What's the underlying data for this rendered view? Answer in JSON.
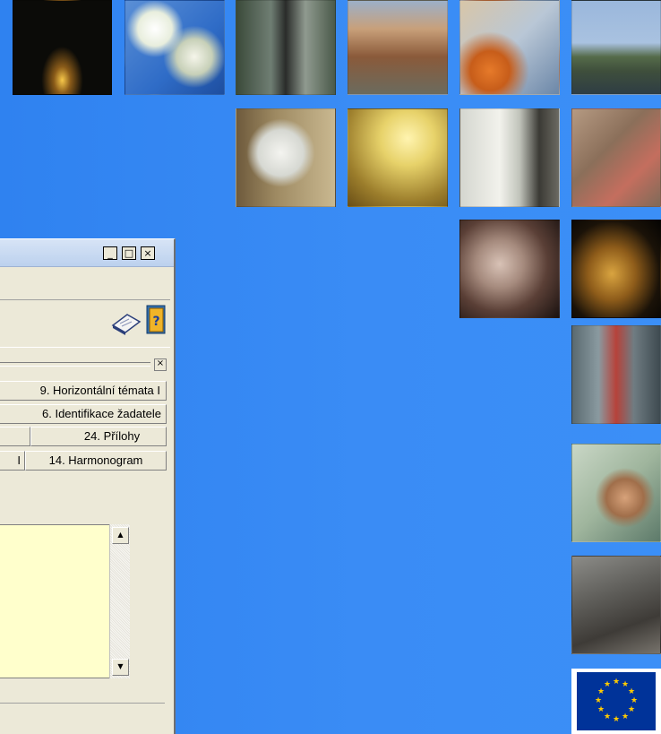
{
  "window": {
    "minimize": "_",
    "maximize": "□",
    "close": "×",
    "inner_close": "×"
  },
  "tabs": [
    {
      "label": "9. Horizontální témata I"
    },
    {
      "label": "6. Identifikace žadatele"
    },
    {
      "label": "24. Přílohy"
    },
    {
      "label": "I"
    },
    {
      "label": "14. Harmonogram"
    }
  ],
  "toolbar": {
    "icons": [
      "document-icon",
      "help-book-icon"
    ]
  },
  "scroll": {
    "up": "▲",
    "down": "▼"
  },
  "colors": {
    "background": "#3a8cf5",
    "window": "#ece9d8",
    "text_panel": "#ffffcc",
    "eu_blue": "#003399",
    "eu_gold": "#ffcc00"
  }
}
